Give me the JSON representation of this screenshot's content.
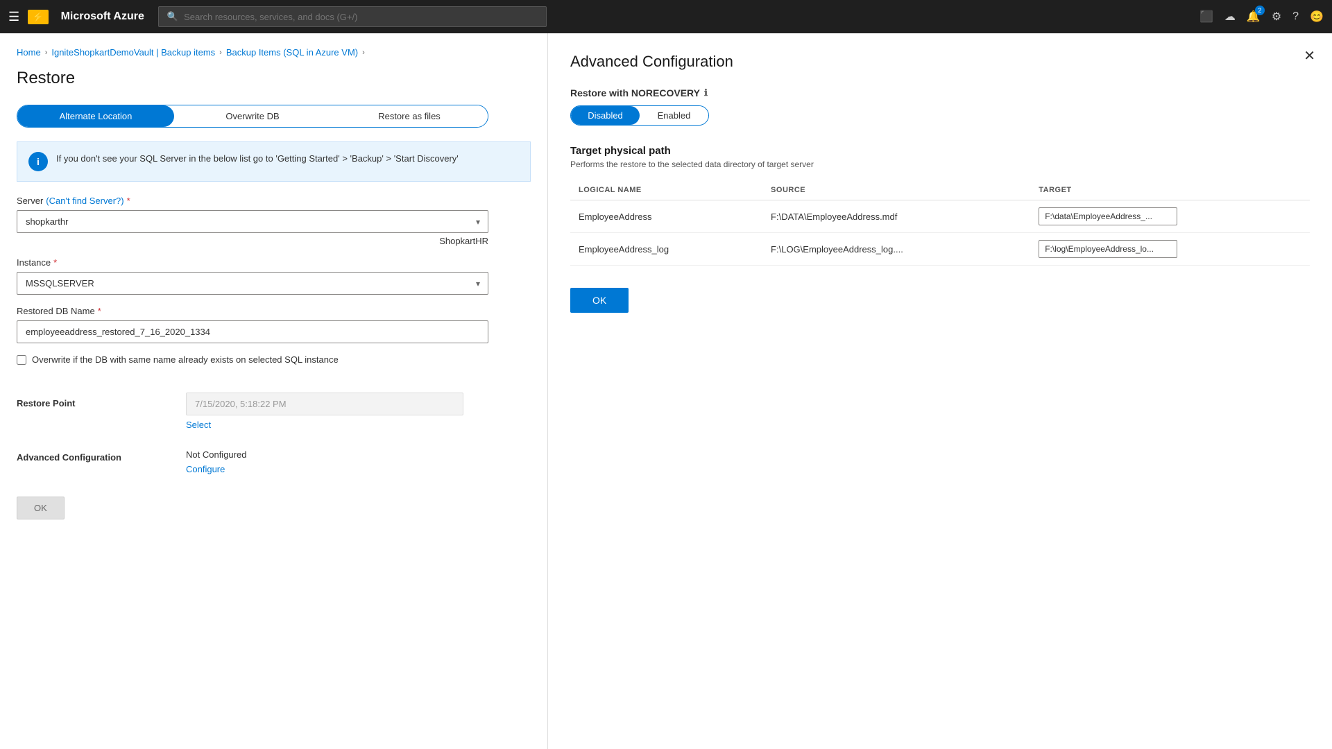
{
  "nav": {
    "hamburger": "☰",
    "logo_icon": "⚡",
    "logo_text": "Microsoft Azure",
    "search_placeholder": "Search resources, services, and docs (G+/)",
    "notification_count": "2",
    "icons": [
      "terminal",
      "cloud-upload",
      "bell",
      "settings",
      "help",
      "smiley"
    ]
  },
  "breadcrumb": {
    "items": [
      "Home",
      "IgniteShopkartDemoVault | Backup items",
      "Backup Items (SQL in Azure VM)"
    ]
  },
  "page_title": "Restore",
  "tabs": {
    "items": [
      {
        "label": "Alternate Location",
        "active": true
      },
      {
        "label": "Overwrite DB",
        "active": false
      },
      {
        "label": "Restore as files",
        "active": false
      }
    ]
  },
  "info_banner": {
    "text": "If you don't see your SQL Server in the below list go to 'Getting Started' > 'Backup' > 'Start Discovery'"
  },
  "form": {
    "server_label": "Server",
    "server_link": "Can't find Server?",
    "server_value": "shopkarthr",
    "server_hint": "ShopkartHR",
    "instance_label": "Instance",
    "instance_required": true,
    "instance_value": "MSSQLSERVER",
    "db_name_label": "Restored DB Name",
    "db_name_required": true,
    "db_name_value": "employeeaddress_restored_7_16_2020_1334",
    "overwrite_label": "Overwrite if the DB with same name already exists on selected SQL instance",
    "restore_point_label": "Restore Point",
    "restore_point_value": "7/15/2020, 5:18:22 PM",
    "select_link": "Select",
    "adv_config_label": "Advanced Configuration",
    "adv_config_value": "Not Configured",
    "configure_link": "Configure",
    "ok_button": "OK"
  },
  "right_panel": {
    "title": "Advanced Configuration",
    "close_icon": "✕",
    "norecovery_label": "Restore with NORECOVERY",
    "norecovery_info": "ℹ",
    "toggle": {
      "disabled_label": "Disabled",
      "enabled_label": "Enabled",
      "active": "Disabled"
    },
    "physical_path": {
      "title": "Target physical path",
      "description": "Performs the restore to the selected data directory of target server",
      "columns": [
        "LOGICAL NAME",
        "SOURCE",
        "TARGET"
      ],
      "rows": [
        {
          "logical_name": "EmployeeAddress",
          "source": "F:\\DATA\\EmployeeAddress.mdf",
          "target": "F:\\data\\EmployeeAddress_..."
        },
        {
          "logical_name": "EmployeeAddress_log",
          "source": "F:\\LOG\\EmployeeAddress_log....",
          "target": "F:\\log\\EmployeeAddress_lo..."
        }
      ]
    },
    "ok_button": "OK"
  }
}
